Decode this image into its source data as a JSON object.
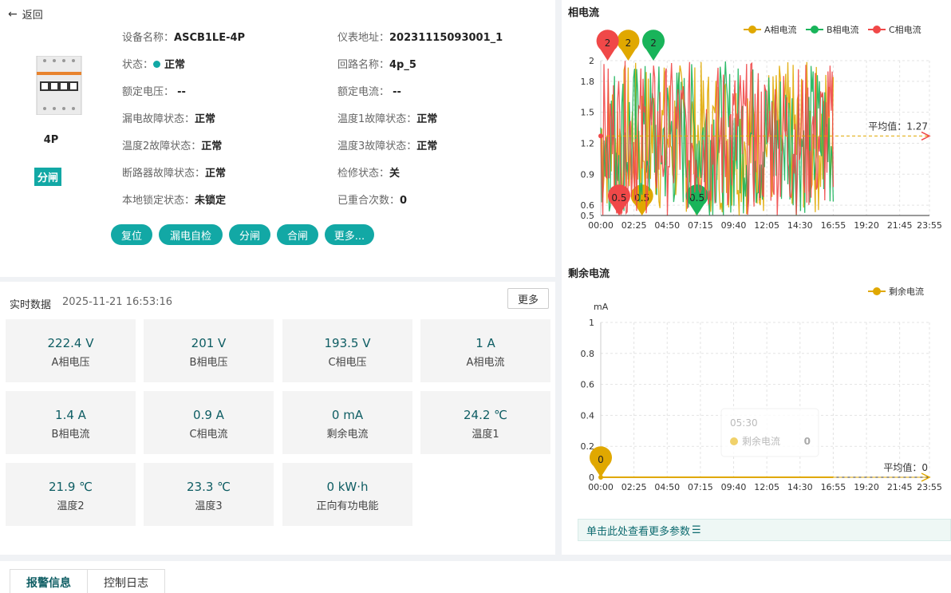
{
  "header": {
    "back_label": "返回"
  },
  "device": {
    "model_label": "4P",
    "switch_state": "分闸",
    "fields": [
      {
        "label": "设备名称：",
        "value": "ASCB1LE-4P"
      },
      {
        "label": "仪表地址：",
        "value": "20231115093001_1"
      },
      {
        "label": "状态：",
        "value": "正常"
      },
      {
        "label": "回路名称：",
        "value": "4p_5"
      },
      {
        "label": "额定电压：",
        "value": "--"
      },
      {
        "label": "额定电流：",
        "value": "--"
      },
      {
        "label": "漏电故障状态：",
        "value": "正常"
      },
      {
        "label": "温度1故障状态：",
        "value": "正常"
      },
      {
        "label": "温度2故障状态：",
        "value": "正常"
      },
      {
        "label": "温度3故障状态：",
        "value": "正常"
      },
      {
        "label": "断路器故障状态：",
        "value": "正常"
      },
      {
        "label": "检修状态：",
        "value": "关"
      },
      {
        "label": "本地锁定状态：",
        "value": "未锁定"
      },
      {
        "label": "已重合次数：",
        "value": "0"
      }
    ],
    "actions": [
      "复位",
      "漏电自检",
      "分闸",
      "合闸",
      "更多..."
    ]
  },
  "realtime": {
    "title": "实时数据",
    "timestamp": "2025-11-21 16:53:16",
    "more_label": "更多",
    "cards": [
      {
        "value": "222.4 V",
        "label": "A相电压"
      },
      {
        "value": "201 V",
        "label": "B相电压"
      },
      {
        "value": "193.5 V",
        "label": "C相电压"
      },
      {
        "value": "1 A",
        "label": "A相电流"
      },
      {
        "value": "1.4 A",
        "label": "B相电流"
      },
      {
        "value": "0.9 A",
        "label": "C相电流"
      },
      {
        "value": "0 mA",
        "label": "剩余电流"
      },
      {
        "value": "24.2 ℃",
        "label": "温度1"
      },
      {
        "value": "21.9 ℃",
        "label": "温度2"
      },
      {
        "value": "23.3 ℃",
        "label": "温度3"
      },
      {
        "value": "0 kW·h",
        "label": "正向有功电能"
      }
    ]
  },
  "chart_data": [
    {
      "type": "line",
      "title": "相电流",
      "x_ticks": [
        "00:00",
        "02:25",
        "04:50",
        "07:15",
        "09:40",
        "12:05",
        "14:30",
        "16:55",
        "19:20",
        "21:45",
        "23:55"
      ],
      "y_ticks": [
        "0.5",
        "0.6",
        "0.9",
        "1.2",
        "1.5",
        "1.8",
        "2"
      ],
      "ylim": [
        0.5,
        2
      ],
      "data_end": "16:55",
      "series": [
        {
          "name": "A相电流",
          "color": "#e0a800",
          "max": 2,
          "min": 0.5,
          "max_at": "02:00",
          "min_at": "03:00"
        },
        {
          "name": "B相电流",
          "color": "#19b45a",
          "max": 2,
          "min": 0.5,
          "max_at": "03:50",
          "min_at": "07:00"
        },
        {
          "name": "C相电流",
          "color": "#f04848",
          "max": 2,
          "min": 0.5,
          "max_at": "00:30",
          "min_at": "01:20"
        }
      ],
      "average_label": "平均值：1.27",
      "average": 1.27,
      "legend_position": "top-right",
      "grid": true
    },
    {
      "type": "line",
      "title": "剩余电流",
      "ylabel": "mA",
      "x_ticks": [
        "00:00",
        "02:25",
        "04:50",
        "07:15",
        "09:40",
        "12:05",
        "14:30",
        "16:55",
        "19:20",
        "21:45",
        "23:55"
      ],
      "y_ticks": [
        "0",
        "0.2",
        "0.4",
        "0.6",
        "0.8",
        "1"
      ],
      "ylim": [
        0,
        1
      ],
      "data_end": "16:55",
      "series": [
        {
          "name": "剩余电流",
          "color": "#e0a800",
          "value": 0,
          "max_label": "0"
        }
      ],
      "average_label": "平均值：0",
      "tooltip": {
        "time": "05:30",
        "series": "剩余电流",
        "value": "0"
      },
      "legend_position": "top-right",
      "grid": true
    }
  ],
  "more_params_label": "单击此处查看更多参数",
  "tabs": [
    "报警信息",
    "控制日志"
  ],
  "colors": {
    "accent": "#12a8a5",
    "a": "#e0a800",
    "b": "#19b45a",
    "c": "#f04848"
  }
}
